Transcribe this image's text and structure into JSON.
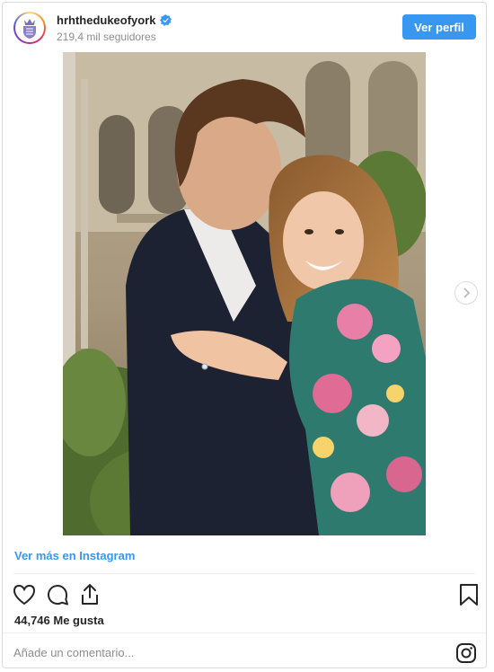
{
  "header": {
    "username": "hrhthedukeofyork",
    "followers": "219,4 mil seguidores",
    "view_profile_label": "Ver perfil",
    "verified_icon": "verified-badge-icon",
    "avatar_icon": "royal-crest-avatar"
  },
  "post": {
    "image_alt": "Engagement photo of a couple embracing",
    "next_icon": "chevron-right-icon"
  },
  "footer": {
    "more_link": "Ver más en Instagram",
    "likes": "44,746 Me gusta",
    "comment_placeholder": "Añade un comentario...",
    "icons": [
      "heart-icon",
      "comment-icon",
      "share-icon",
      "bookmark-icon",
      "instagram-logo-icon"
    ]
  },
  "colors": {
    "accent": "#3897f0",
    "text": "#262626",
    "muted": "#8e8e8e",
    "border": "#dbdbdb"
  }
}
